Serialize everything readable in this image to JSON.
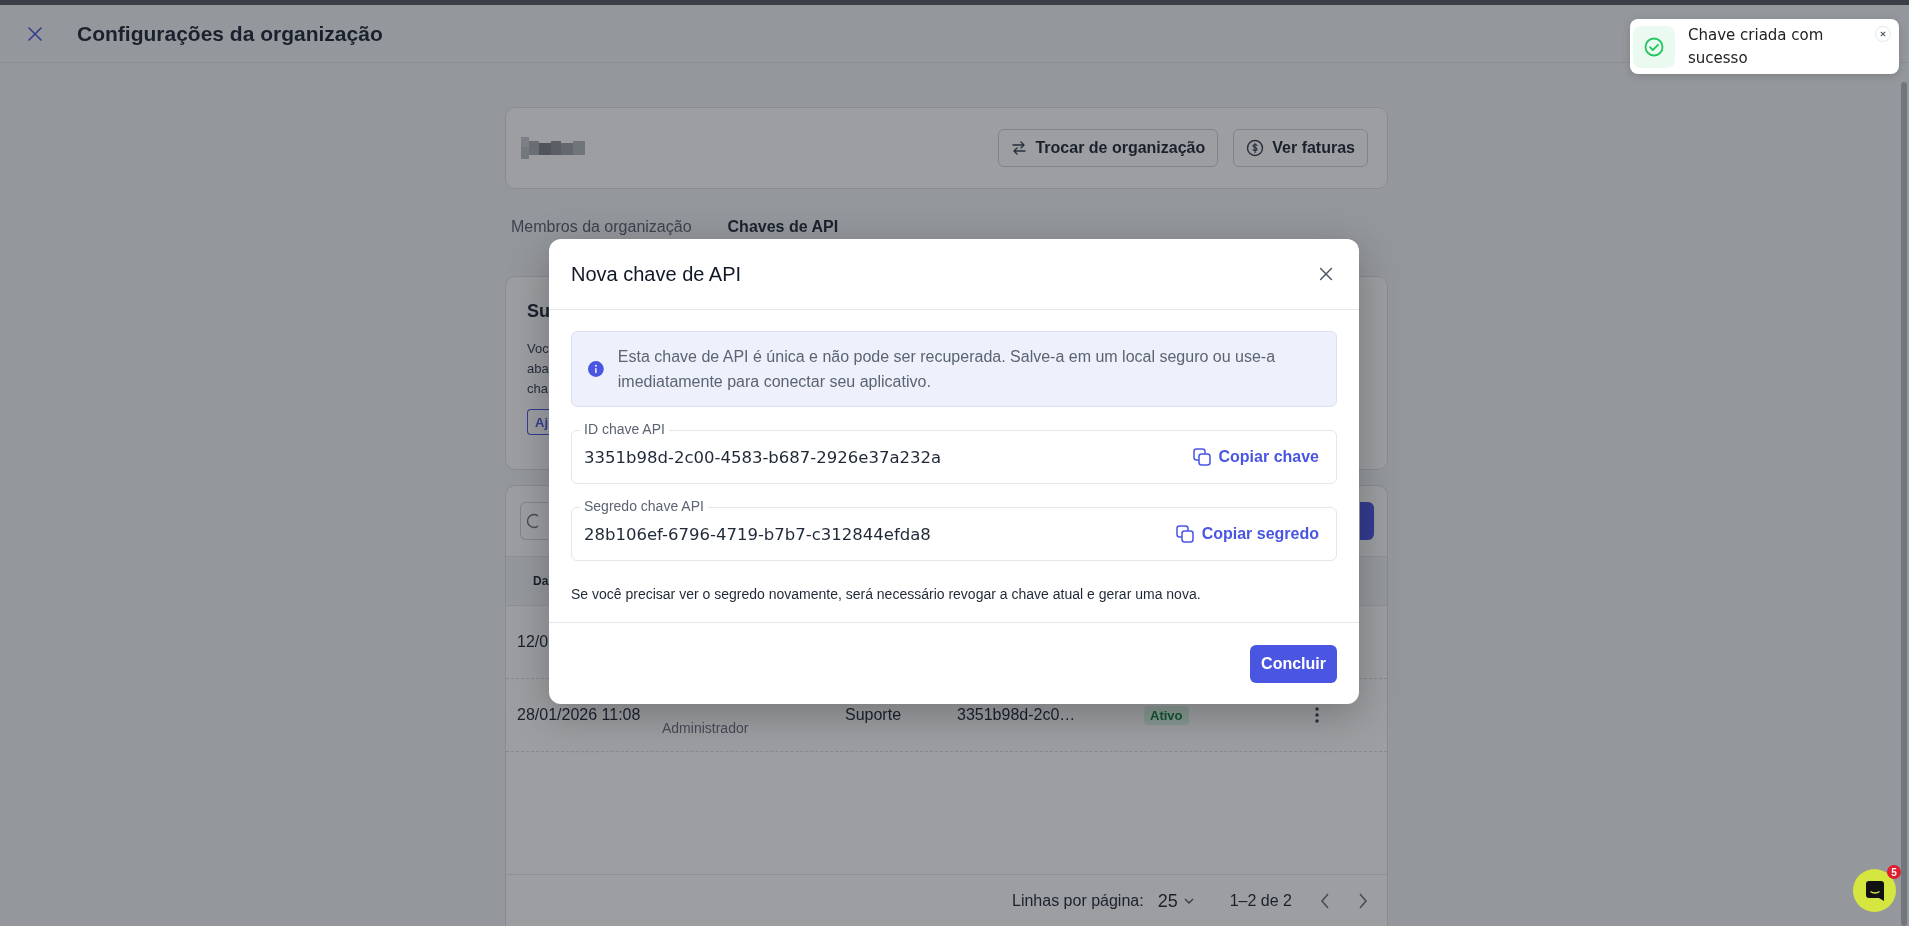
{
  "header": {
    "title": "Configurações da organização"
  },
  "organization": {
    "buttons": [
      {
        "label": "Trocar de organização"
      },
      {
        "label": "Ver faturas"
      }
    ]
  },
  "tabs": [
    {
      "label": "Membros da organização",
      "selected": false
    },
    {
      "label": "Chaves de API",
      "selected": true
    }
  ],
  "summary_card": {
    "title": "Su",
    "lines": [
      "Voc",
      "aba",
      "cha"
    ],
    "button": "Aj"
  },
  "table": {
    "columns": [
      "Da"
    ],
    "rows": [
      {
        "date": "12/0"
      },
      {
        "date": "28/01/2026 11:08",
        "role": "Administrador",
        "column_3": "Suporte",
        "key": "3351b98d-2c0…",
        "status": "Ativo"
      }
    ],
    "pagination": {
      "rows_label": "Linhas por página:",
      "rows_value": "25",
      "range": "1–2 de 2"
    }
  },
  "modal": {
    "title": "Nova chave de API",
    "info": "Esta chave de API é única e não pode ser recuperada. Salve-a em um local seguro ou use-a imediatamente para conectar seu aplicativo.",
    "fields": [
      {
        "label": "ID chave API",
        "value": "3351b98d-2c00-4583-b687-2926e37a232a",
        "action": "Copiar chave"
      },
      {
        "label": "Segredo chave API",
        "value": "28b106ef-6796-4719-b7b7-c312844efda8",
        "action": "Copiar segredo"
      }
    ],
    "note": "Se você precisar ver o segredo novamente, será necessário revogar a chave atual e gerar uma nova.",
    "button": "Concluir"
  },
  "toast": {
    "kind": "success",
    "message": "Chave criada com sucesso"
  },
  "chat_launcher": {
    "badge": "5"
  }
}
